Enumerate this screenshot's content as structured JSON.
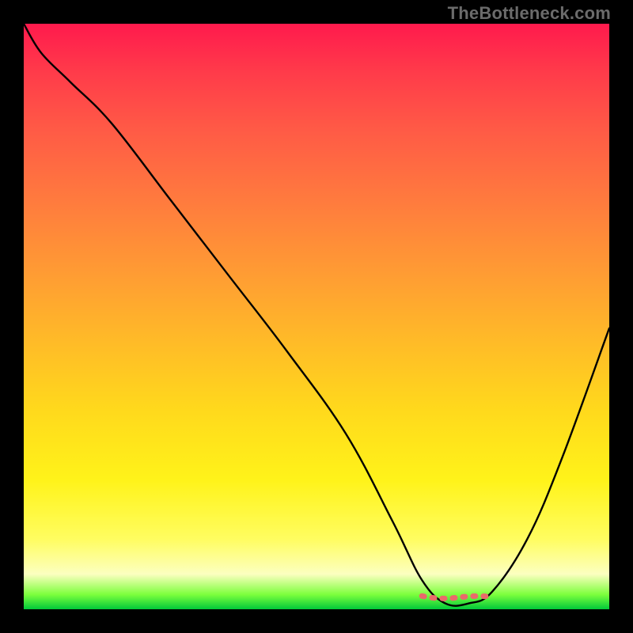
{
  "watermark": "TheBottleneck.com",
  "colors": {
    "background": "#000000",
    "gradient_top": "#ff1a4d",
    "gradient_bottom": "#00c93a",
    "curve": "#000000",
    "valley_marker": "#e96a6a"
  },
  "chart_data": {
    "type": "line",
    "title": "",
    "xlabel": "",
    "ylabel": "",
    "xlim": [
      0,
      100
    ],
    "ylim": [
      0,
      100
    ],
    "grid": false,
    "legend": false,
    "series": [
      {
        "name": "bottleneck-curve",
        "x": [
          0,
          3,
          8,
          15,
          25,
          35,
          45,
          55,
          63,
          68,
          72,
          76,
          80,
          86,
          92,
          100
        ],
        "y": [
          100,
          95,
          90,
          83,
          70,
          57,
          44,
          30,
          15,
          5,
          1,
          1,
          3,
          12,
          26,
          48
        ]
      }
    ],
    "annotations": [
      {
        "name": "valley-marker",
        "shape": "dashed-segment",
        "x_range": [
          68,
          80
        ],
        "y": 2,
        "color": "#e96a6a"
      }
    ]
  }
}
